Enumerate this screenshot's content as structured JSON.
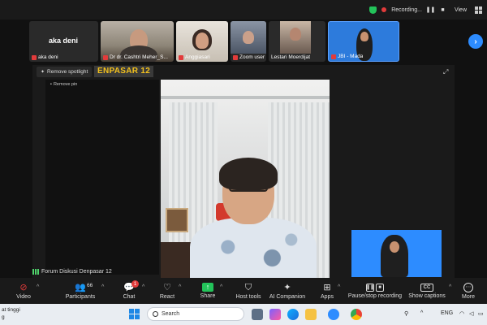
{
  "topbar": {
    "recording_label": "Recording...",
    "view_label": "View"
  },
  "gallery": {
    "tiles": [
      {
        "name": "aka deni",
        "big_name": "aka deni"
      },
      {
        "name": "Dr dr. Cashtri Meher_S..."
      },
      {
        "name": "Anggiasari"
      },
      {
        "name": "Zoom user"
      },
      {
        "name": "Lestari Moerdijat"
      },
      {
        "name": "JBI - Mada"
      }
    ],
    "next_icon": "chevron-right-icon"
  },
  "spotlight": {
    "remove_label": "Remove spotlight",
    "badge_text": "ENPASAR 12",
    "remove_pin_label": "Remove pin"
  },
  "meeting": {
    "name": "Forum Diskusi Denpasar 12"
  },
  "toolbar": {
    "video_label": "Video",
    "participants_label": "Participants",
    "participants_count": "66",
    "chat_label": "Chat",
    "chat_badge": "1",
    "react_label": "React",
    "share_label": "Share",
    "host_tools_label": "Host tools",
    "ai_label": "AI Companion",
    "apps_label": "Apps",
    "pause_label": "Pause/stop recording",
    "captions_label": "Show captions",
    "more_label": "More"
  },
  "taskbar": {
    "weather_line1": "at tinggi",
    "weather_line2": "g",
    "search_placeholder": "Search",
    "lang": "ENG"
  },
  "colors": {
    "accent": "#2d8cff",
    "badge_yellow": "#f4c21d",
    "recording_red": "#e23b3b",
    "share_green": "#23c35a"
  }
}
